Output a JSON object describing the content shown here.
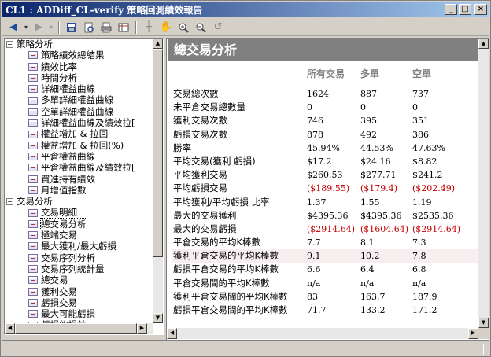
{
  "window": {
    "title": "CL1 : ADDiff_CL-verify 策略回測績效報告",
    "buttons": {
      "minimize": "_",
      "maximize": "□",
      "close": "×"
    }
  },
  "toolbar": {
    "icons": [
      "back-arrow-icon",
      "forward-arrow-icon",
      "save-icon",
      "preview-icon",
      "print-icon",
      "grid-icon",
      "crosshair-icon",
      "hand-icon",
      "zoom-in-icon",
      "zoom-out-icon",
      "undo-zoom-icon"
    ]
  },
  "tree": {
    "groups": [
      {
        "label": "策略分析",
        "expander": "−",
        "items": [
          "策略績效總結果",
          "績效比率",
          "時間分析",
          "詳細權益曲線",
          "多單詳細權益曲線",
          "空單詳細權益曲線",
          "詳細權益曲線及績效拉[",
          "權益增加 & 拉回",
          "權益增加 & 拉回(%)",
          "平倉權益曲線",
          "平倉權益曲線及績效拉[",
          "買進持有績效",
          "月增值指數"
        ]
      },
      {
        "label": "交易分析",
        "expander": "−",
        "items": [
          "交易明細",
          "總交易分析",
          "極端交易",
          "最大獲利/最大虧損",
          "交易序列分析",
          "交易序列統計量",
          "總交易",
          "獲利交易",
          "虧損交易",
          "最大可能虧損",
          "虧損的損益"
        ]
      }
    ],
    "selected": "總交易分析"
  },
  "content": {
    "header": "總交易分析",
    "columns": [
      "所有交易",
      "多單",
      "空單"
    ],
    "rows": [
      {
        "label": "交易總次數",
        "all": "1624",
        "long": "887",
        "short": "737"
      },
      {
        "label": "未平倉交易總數量",
        "all": "0",
        "long": "0",
        "short": "0"
      },
      {
        "label": "獲利交易次數",
        "all": "746",
        "long": "395",
        "short": "351"
      },
      {
        "label": "虧損交易次數",
        "all": "878",
        "long": "492",
        "short": "386"
      },
      {
        "label": "勝率",
        "all": "45.94%",
        "long": "44.53%",
        "short": "47.63%"
      },
      {
        "label": "平均交易(獲利 虧損)",
        "all": "$17.2",
        "long": "$24.16",
        "short": "$8.82"
      },
      {
        "label": "平均獲利交易",
        "all": "$260.53",
        "long": "$277.71",
        "short": "$241.2"
      },
      {
        "label": "平均虧損交易",
        "all": "($189.55)",
        "long": "($179.4)",
        "short": "($202.49)",
        "negative": true
      },
      {
        "label": "平均獲利/平均虧損 比率",
        "all": "1.37",
        "long": "1.55",
        "short": "1.19"
      },
      {
        "label": "最大的交易獲利",
        "all": "$4395.36",
        "long": "$4395.36",
        "short": "$2535.36"
      },
      {
        "label": "最大的交易虧損",
        "all": "($2914.64)",
        "long": "($1604.64)",
        "short": "($2914.64)",
        "negative": true
      },
      {
        "label": "平倉交易的平均K棒數",
        "all": "7.7",
        "long": "8.1",
        "short": "7.3"
      },
      {
        "label": "獲利平倉交易的平均K棒數",
        "all": "9.1",
        "long": "10.2",
        "short": "7.8",
        "highlight": true
      },
      {
        "label": "虧損平倉交易的平均K棒數",
        "all": "6.6",
        "long": "6.4",
        "short": "6.8"
      },
      {
        "label": "平倉交易間的平均K棒數",
        "all": "n/a",
        "long": "n/a",
        "short": "n/a"
      },
      {
        "label": "獲利平倉交易間的平均K棒數",
        "all": "83",
        "long": "163.7",
        "short": "187.9"
      },
      {
        "label": "虧損平倉交易間的平均K棒數",
        "all": "71.7",
        "long": "133.2",
        "short": "171.2"
      }
    ]
  }
}
